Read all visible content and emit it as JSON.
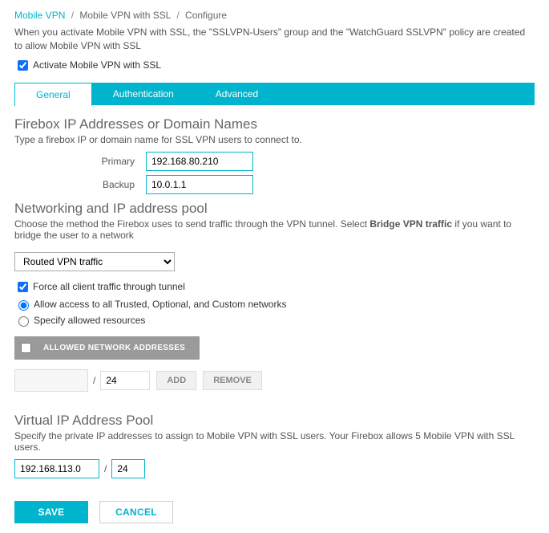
{
  "breadcrumb": {
    "link": "Mobile VPN",
    "part2": "Mobile VPN with SSL",
    "part3": "Configure"
  },
  "intro": "When you activate Mobile VPN with SSL, the \"SSLVPN-Users\" group and the \"WatchGuard SSLVPN\" policy are created to allow Mobile VPN with SSL",
  "activate_label": "Activate Mobile VPN with SSL",
  "tabs": {
    "general": "General",
    "authentication": "Authentication",
    "advanced": "Advanced"
  },
  "firebox": {
    "title": "Firebox IP Addresses or Domain Names",
    "sub": "Type a firebox IP or domain name for SSL VPN users to connect to.",
    "primary_label": "Primary",
    "primary_value": "192.168.80.210",
    "backup_label": "Backup",
    "backup_value": "10.0.1.1"
  },
  "networking": {
    "title": "Networking and IP address pool",
    "sub_a": "Choose the method the Firebox uses to send traffic through the VPN tunnel. Select ",
    "sub_b": "Bridge VPN traffic",
    "sub_c": " if you want to bridge the user to a network",
    "mode_selected": "Routed VPN traffic",
    "force_label": "Force all client traffic through tunnel",
    "allow_label": "Allow access to all Trusted, Optional, and Custom networks",
    "specify_label": "Specify allowed resources",
    "allowed_header": "ALLOWED NETWORK ADDRESSES",
    "prefix_value": "24",
    "add_label": "ADD",
    "remove_label": "REMOVE"
  },
  "virtual": {
    "title": "Virtual IP Address Pool",
    "sub": "Specify the private IP addresses to assign to Mobile VPN with SSL users. Your Firebox allows 5 Mobile VPN with SSL users.",
    "ip_value": "192.168.113.0",
    "prefix_value": "24"
  },
  "actions": {
    "save": "SAVE",
    "cancel": "CANCEL"
  }
}
